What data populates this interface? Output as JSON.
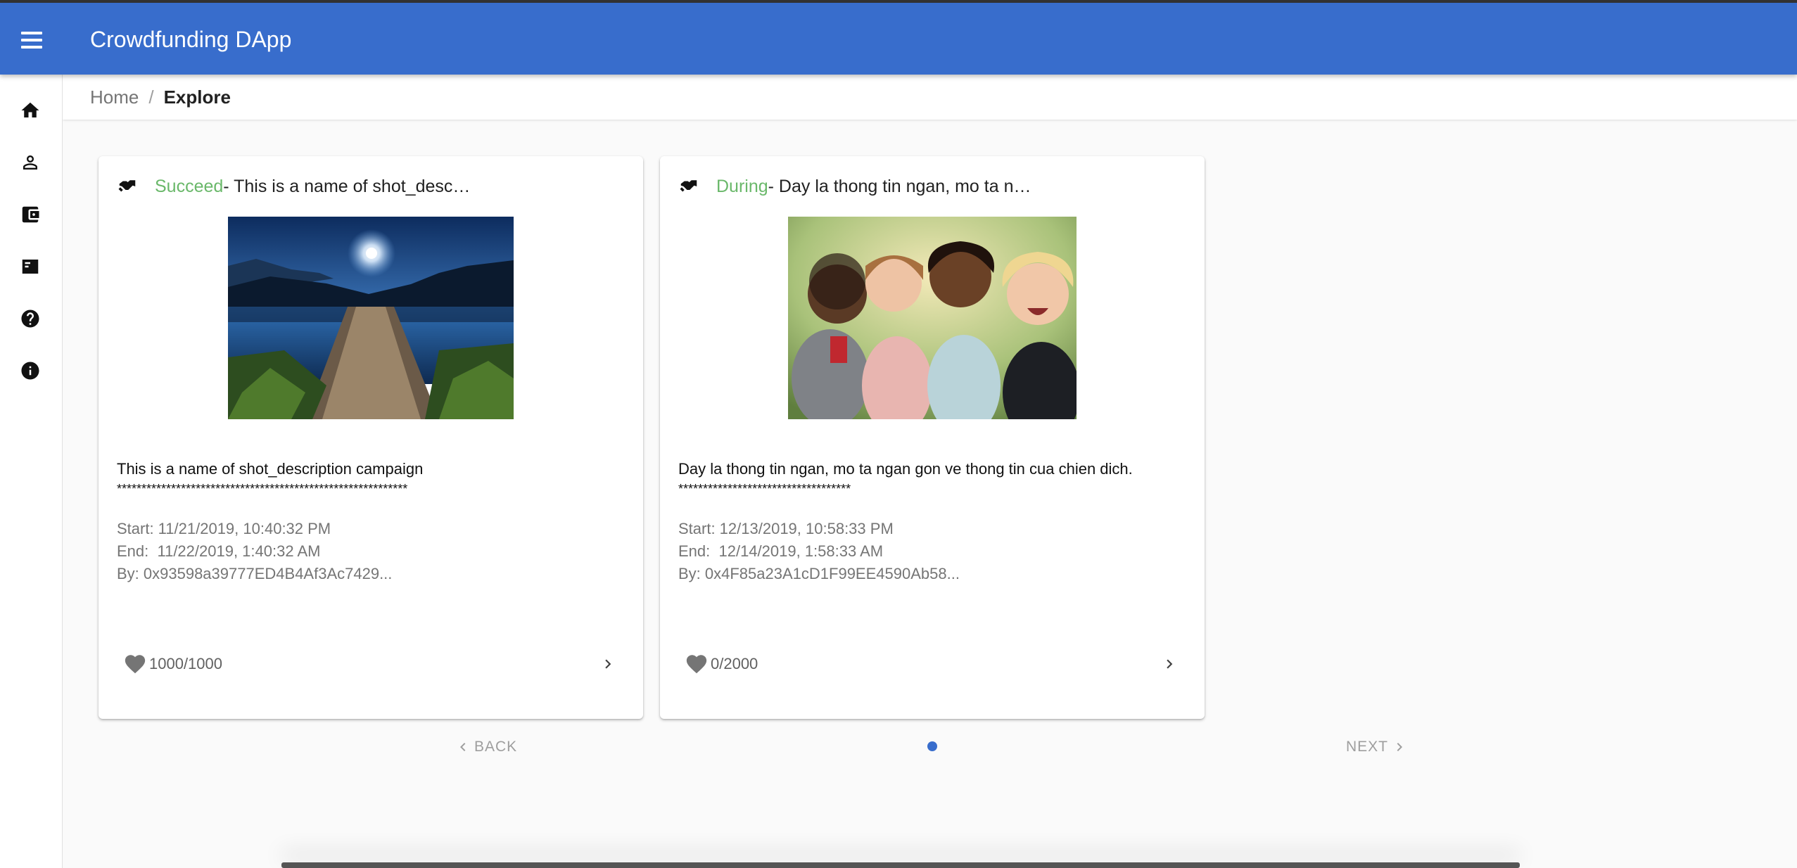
{
  "app": {
    "title": "Crowdfunding DApp",
    "accent_color": "#386dcc",
    "status_color": "#6ab86a"
  },
  "sidebar": {
    "items": [
      {
        "icon": "home-icon"
      },
      {
        "icon": "person-icon"
      },
      {
        "icon": "wallet-icon"
      },
      {
        "icon": "campaign-list-icon"
      },
      {
        "icon": "help-icon"
      },
      {
        "icon": "info-icon"
      }
    ]
  },
  "breadcrumb": {
    "home": "Home",
    "separator": "/",
    "current": "Explore"
  },
  "campaigns": [
    {
      "status": "Succeed",
      "title": " - This is a name of shot_desc…",
      "image": "lake-pier-moonlight",
      "description": "This is a name of shot_description campaign",
      "stars": "***********************************************************",
      "start": "Start: 11/21/2019, 10:40:32 PM",
      "end": "End:  11/22/2019, 1:40:32 AM",
      "by": "By: 0x93598a39777ED4B4Af3Ac7429...",
      "likes": "1000/1000"
    },
    {
      "status": "During",
      "title": " - Day la thong tin ngan, mo ta n…",
      "image": "smiling-children",
      "description": "Day la thong tin ngan, mo ta ngan gon ve thong tin cua chien dich.",
      "stars": "***********************************",
      "start": "Start: 12/13/2019, 10:58:33 PM",
      "end": "End:  12/14/2019, 1:58:33 AM",
      "by": "By: 0x4F85a23A1cD1F99EE4590Ab58...",
      "likes": "0/2000"
    }
  ],
  "pagination": {
    "back_label": "BACK",
    "next_label": "NEXT"
  }
}
